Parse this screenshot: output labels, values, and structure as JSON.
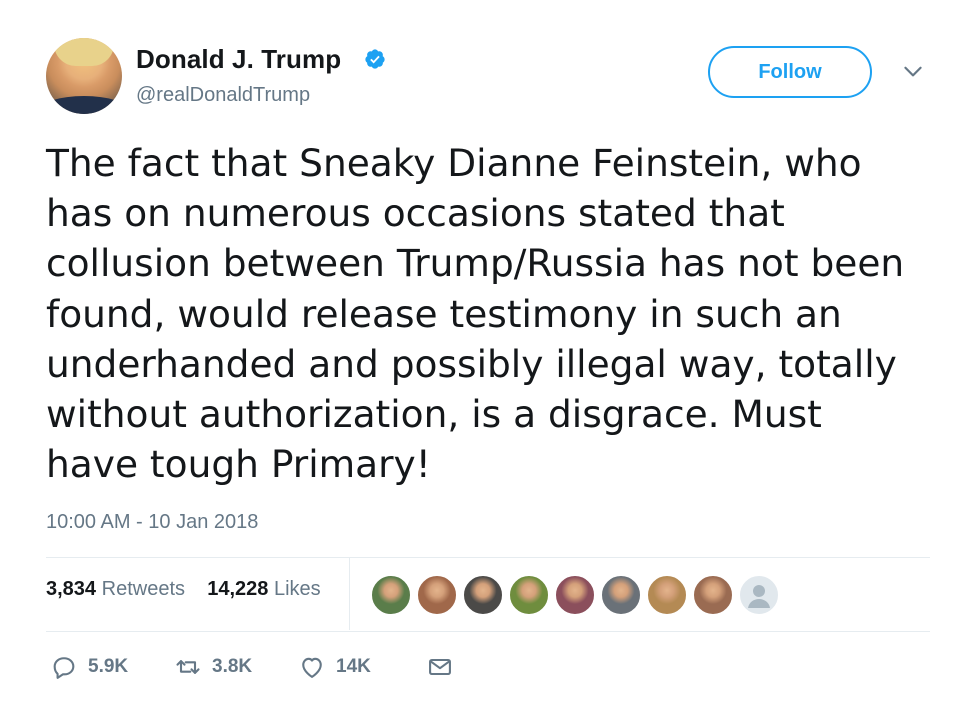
{
  "author": {
    "name": "Donald J. Trump",
    "handle": "@realDonaldTrump",
    "verified_icon": "verified-badge-icon",
    "brand_color": "#1da1f2"
  },
  "follow_label": "Follow",
  "tweet": {
    "lines": [
      "The fact that Sneaky Dianne Feinstein, who",
      "has on numerous occasions stated that",
      "collusion between Trump/Russia has not been",
      "found, would release testimony in such an",
      "underhanded and possibly illegal way, totally",
      "without authorization, is a disgrace. Must",
      "have tough Primary!"
    ],
    "timestamp": "10:00 AM - 10 Jan 2018"
  },
  "stats": {
    "retweets_count": "3,834",
    "retweets_label": "Retweets",
    "likes_count": "14,228",
    "likes_label": "Likes"
  },
  "liker_avatars": [
    {
      "color": "#5a7d4a"
    },
    {
      "color": "#a0684a"
    },
    {
      "color": "#4b4a48"
    },
    {
      "color": "#6f8d3e"
    },
    {
      "color": "#8b4f5c"
    },
    {
      "color": "#6a7178"
    },
    {
      "color": "#b48a54"
    },
    {
      "color": "#9a6b52"
    },
    {
      "color": "#ccd6dd"
    }
  ],
  "actions": {
    "reply_count": "5.9K",
    "retweet_count": "3.8K",
    "like_count": "14K"
  }
}
